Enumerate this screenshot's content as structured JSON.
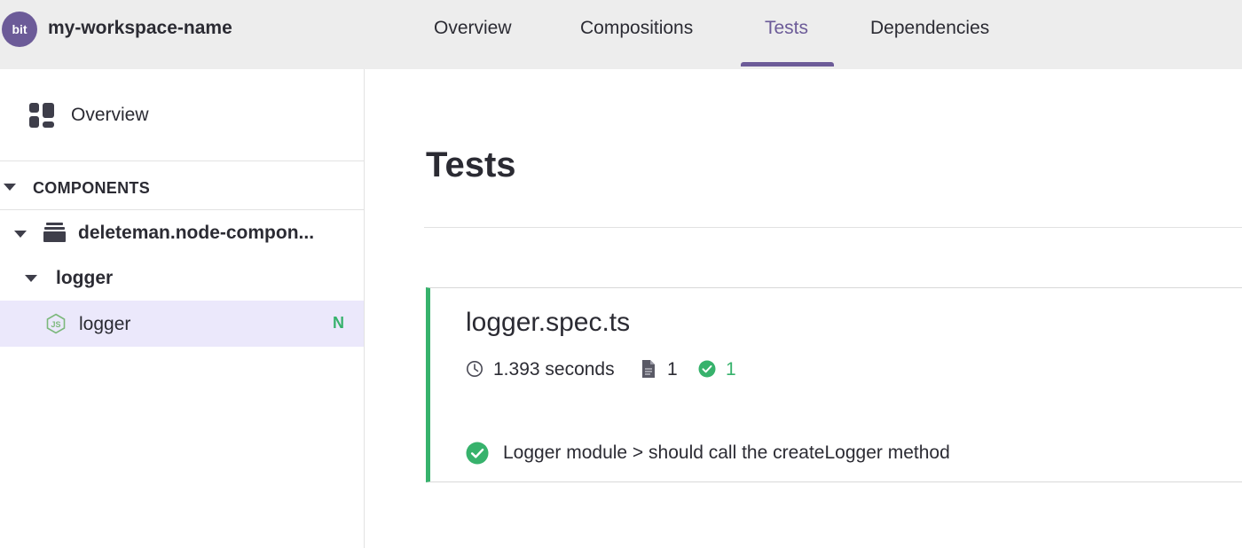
{
  "header": {
    "logo_text": "bit",
    "workspace_name": "my-workspace-name",
    "tabs": [
      {
        "label": "Overview",
        "active": false
      },
      {
        "label": "Compositions",
        "active": false
      },
      {
        "label": "Tests",
        "active": true
      },
      {
        "label": "Dependencies",
        "active": false
      }
    ]
  },
  "sidebar": {
    "overview_label": "Overview",
    "components_label": "COMPONENTS",
    "scope_label": "deleteman.node-compon...",
    "folder_label": "logger",
    "items": [
      {
        "label": "logger",
        "icon": "nodejs-icon",
        "status": "N",
        "selected": true
      }
    ]
  },
  "main": {
    "title": "Tests",
    "test_file": {
      "name": "logger.spec.ts",
      "duration": "1.393 seconds",
      "file_count": "1",
      "passed_count": "1",
      "tests": [
        {
          "name": "Logger module > should call the createLogger method",
          "status": "passed"
        }
      ]
    }
  },
  "colors": {
    "accent": "#6c5b98",
    "success": "#37b26c",
    "topbar_bg": "#ededed",
    "selected_bg": "#ebe8fb"
  }
}
